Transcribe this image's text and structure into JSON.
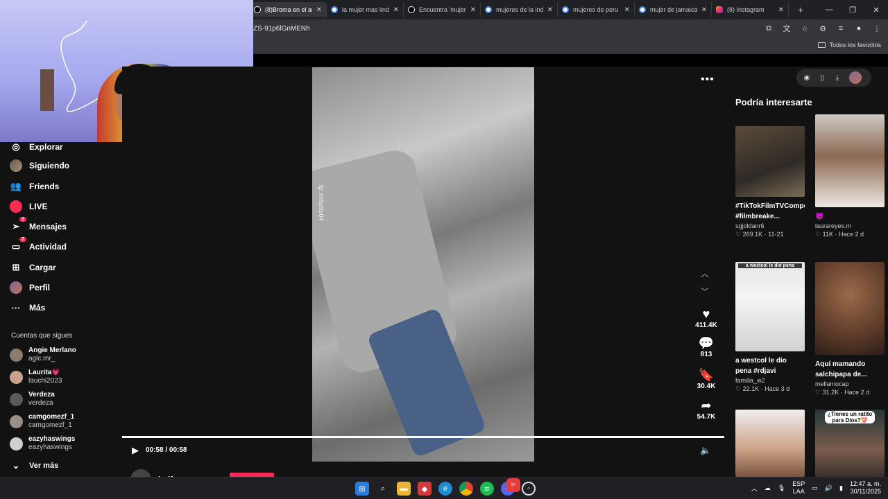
{
  "browser": {
    "tabs": [
      {
        "title": "(8)Broma en el as",
        "favicon_color": "#000000",
        "active": true
      },
      {
        "title": "la mujer mas lind",
        "favicon_color": "#4285f4",
        "active": false
      },
      {
        "title": "Encuentra 'mujer",
        "favicon_color": "#000000",
        "active": false
      },
      {
        "title": "mujeres de la ind",
        "favicon_color": "#4285f4",
        "active": false
      },
      {
        "title": "mujeres de peru",
        "favicon_color": "#4285f4",
        "active": false
      },
      {
        "title": "mujer de jamaica",
        "favicon_color": "#4285f4",
        "active": false
      },
      {
        "title": "(8) Instagram",
        "favicon_color": "#e1306c",
        "active": false
      }
    ],
    "url_fragment": "ZS-91p6lGnMENh",
    "bookmarks_label": "Todos los favoritos"
  },
  "sidebar": {
    "items": [
      {
        "label": "Explorar",
        "icon": "compass-icon"
      },
      {
        "label": "Siguiendo",
        "icon": "avatar-icon"
      },
      {
        "label": "Friends",
        "icon": "friends-icon"
      },
      {
        "label": "LIVE",
        "icon": "live-icon"
      },
      {
        "label": "Mensajes",
        "icon": "send-icon",
        "badge": "1"
      },
      {
        "label": "Actividad",
        "icon": "activity-icon",
        "badge": "7"
      },
      {
        "label": "Cargar",
        "icon": "upload-icon"
      },
      {
        "label": "Perfil",
        "icon": "profile-icon"
      },
      {
        "label": "Más",
        "icon": "more-icon"
      }
    ],
    "following_title": "Cuentas que sigues",
    "following": [
      {
        "name": "Angie Merlano",
        "user": "aglc.mr_"
      },
      {
        "name": "Laurita💗",
        "user": "lauchi2023"
      },
      {
        "name": "Verdeza",
        "user": "verdeza"
      },
      {
        "name": "camgomezf_1",
        "user": "camgomezf_1"
      },
      {
        "name": "eazyhaswings",
        "user": "eazyhaswings"
      }
    ],
    "see_more": "Ver más"
  },
  "video": {
    "watermark": "ig: nirlante04",
    "likes": "411.4K",
    "comments": "813",
    "saves": "30.4K",
    "shares": "54.7K",
    "time": "00:58 / 00:58",
    "progress": 1.0,
    "author": "halfynnx"
  },
  "right": {
    "title": "Podría interesarte",
    "cards": [
      {
        "caption": "#TikTokFilmTVCompetition #filmbreake...",
        "user": "sgjoldanr6",
        "likes": "269.1K",
        "date": "11-21"
      },
      {
        "caption": "😈",
        "user": "laurareyes.m",
        "likes": "11K",
        "date": "Hace 2 d"
      },
      {
        "caption": "a westcol le dio pena #rdjavi #westcol...",
        "user": "familia_w2",
        "likes": "22.1K",
        "date": "Hace 3 d",
        "overlay": "a westcol le dio pena"
      },
      {
        "caption": "Aquí mamando salchipapa de...",
        "user": "mellamocap",
        "likes": "31.2K",
        "date": "Hace 2 d"
      },
      {
        "caption": "",
        "user": "",
        "likes": "",
        "date": ""
      },
      {
        "caption": "",
        "user": "",
        "likes": "",
        "date": "",
        "overlay": "¿Tienes un ratito para Dios?💝"
      }
    ]
  },
  "taskbar": {
    "lang1": "ESP",
    "lang2": "LAA",
    "time": "12:47 a. m.",
    "date": "30/11/2025",
    "discord_badge": "9+"
  },
  "colors": {
    "accent": "#fe2c55",
    "bg": "#121212"
  }
}
